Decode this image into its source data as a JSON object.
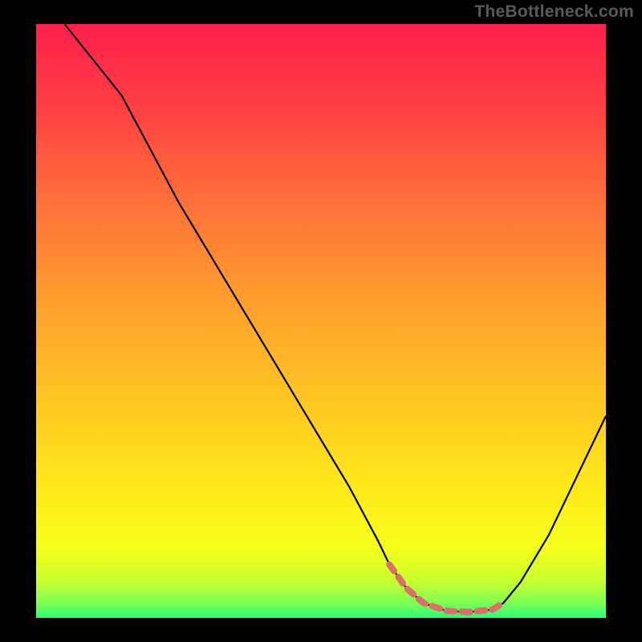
{
  "watermark": "TheBottleneck.com",
  "colors": {
    "gradient_stops": [
      {
        "offset": 0.0,
        "color": "#ff1f4b"
      },
      {
        "offset": 0.12,
        "color": "#ff3a45"
      },
      {
        "offset": 0.28,
        "color": "#ff6a3a"
      },
      {
        "offset": 0.45,
        "color": "#ff9a2f"
      },
      {
        "offset": 0.62,
        "color": "#ffc323"
      },
      {
        "offset": 0.78,
        "color": "#ffe91a"
      },
      {
        "offset": 0.88,
        "color": "#f6ff1a"
      },
      {
        "offset": 0.94,
        "color": "#c6ff2f"
      },
      {
        "offset": 0.975,
        "color": "#7fff55"
      },
      {
        "offset": 1.0,
        "color": "#2cff77"
      }
    ],
    "curve": "#000000",
    "marker": "#d9706a"
  },
  "chart_data": {
    "type": "line",
    "title": "",
    "xlabel": "",
    "ylabel": "",
    "xlim": [
      0,
      100
    ],
    "ylim": [
      0,
      100
    ],
    "grid": false,
    "legend": false,
    "series": [
      {
        "name": "bottleneck",
        "x": [
          5,
          10,
          15,
          20,
          25,
          30,
          35,
          40,
          45,
          50,
          55,
          60,
          62,
          65,
          68,
          72,
          76,
          80,
          82,
          85,
          90,
          95,
          100
        ],
        "y": [
          100,
          94,
          88,
          79,
          70,
          62,
          54,
          46,
          38,
          30,
          22,
          13,
          9,
          5,
          2.5,
          1.2,
          1.0,
          1.4,
          2.5,
          6,
          14,
          24,
          34
        ]
      }
    ],
    "optimal_range": {
      "x": [
        62,
        65,
        68,
        72,
        76,
        80,
        82
      ],
      "y": [
        9,
        5,
        2.5,
        1.2,
        1.0,
        1.4,
        2.5
      ]
    },
    "marker_style": {
      "stroke_width": 8,
      "dash": [
        10,
        9
      ]
    }
  }
}
